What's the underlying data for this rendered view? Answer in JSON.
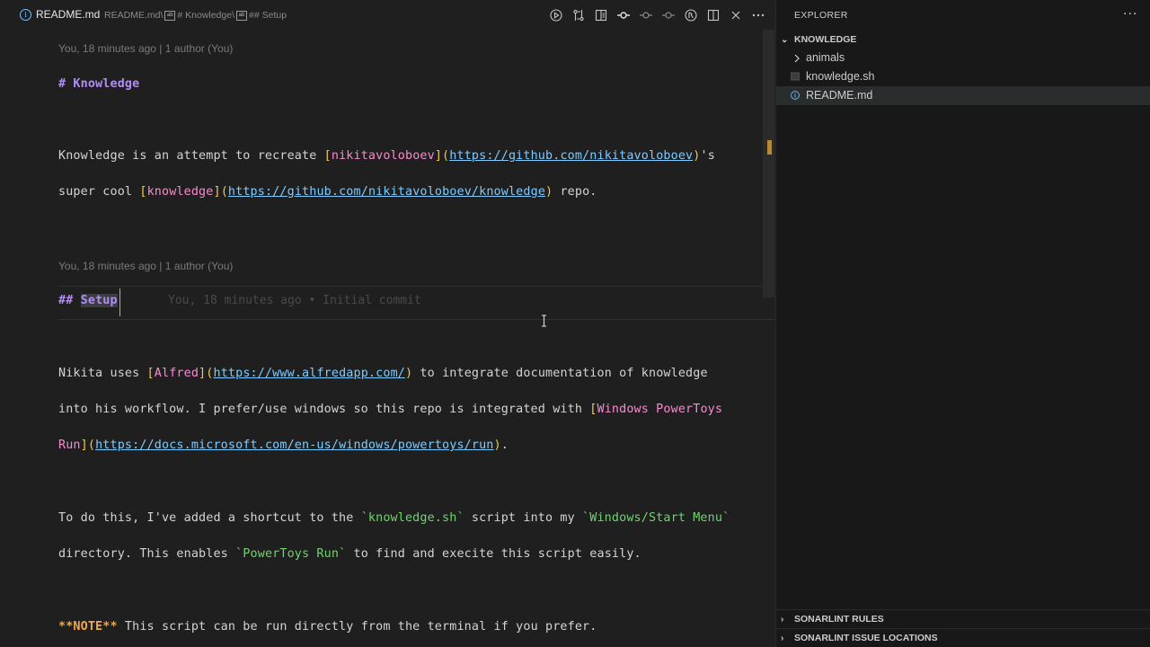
{
  "editor": {
    "tab_title": "README.md",
    "breadcrumb": {
      "file": "README.md",
      "sep": "\\",
      "heading1": "# Knowledge",
      "heading2": "## Setup"
    },
    "action_icons": [
      "run-icon",
      "compare-changes-icon",
      "open-preview-icon",
      "git-commit-icon",
      "git-previous-icon",
      "git-next-icon",
      "blame-toggle-icon",
      "split-editor-icon",
      "close-icon",
      "more-actions-icon"
    ],
    "codelens_1": "You, 18 minutes ago | 1 author (You)",
    "codelens_2": "You, 18 minutes ago | 1 author (You)",
    "ghost_blame": "You, 18 minutes ago • Initial commit",
    "lines": {
      "l1": {
        "text": "# Knowledge"
      },
      "l2": {
        "a": "Knowledge is an attempt to recreate ",
        "b1": "[",
        "link_text": "nikitavoloboev",
        "b2": "](",
        "url": "https://github.com/nikitavoloboev",
        "b3": ")",
        "c": "'s"
      },
      "l3": {
        "a": "super cool ",
        "b1": "[",
        "link_text": "knowledge",
        "b2": "](",
        "url": "https://github.com/nikitavoloboev/knowledge",
        "b3": ")",
        "c": " repo."
      },
      "l4": {
        "hash": "## ",
        "text": "Setup"
      },
      "l5": {
        "a": "Nikita uses ",
        "b1": "[",
        "link_text": "Alfred",
        "b2": "](",
        "url": "https://www.alfredapp.com/",
        "b3": ")",
        "c": " to integrate documentation of knowledge"
      },
      "l6": {
        "a": "into his workflow. I prefer/use windows so this repo is integrated with ",
        "b1": "[",
        "link_text": "Windows PowerToys"
      },
      "l7": {
        "link_text": "Run",
        "b2": "](",
        "url": "https://docs.microsoft.com/en-us/windows/powertoys/run",
        "b3": ")",
        "c": "."
      },
      "l8": {
        "a": "To do this, I've added a shortcut to the ",
        "code1": "`knowledge.sh`",
        "b": " script into my ",
        "code2": "`Windows/Start Menu`"
      },
      "l9": {
        "a": "directory. This enables ",
        "code": "`PowerToys Run`",
        "b": " to find and execite this script easily."
      },
      "l10": {
        "note": "**NOTE**",
        "a": " This script can be run directly from the terminal if you prefer."
      }
    }
  },
  "sidebar": {
    "title": "EXPLORER",
    "folder": "KNOWLEDGE",
    "items": [
      {
        "label": "animals",
        "kind": "folder"
      },
      {
        "label": "knowledge.sh",
        "kind": "file"
      },
      {
        "label": "README.md",
        "kind": "file",
        "selected": true
      }
    ],
    "sections": [
      "SONARLINT RULES",
      "SONARLINT ISSUE LOCATIONS"
    ]
  }
}
